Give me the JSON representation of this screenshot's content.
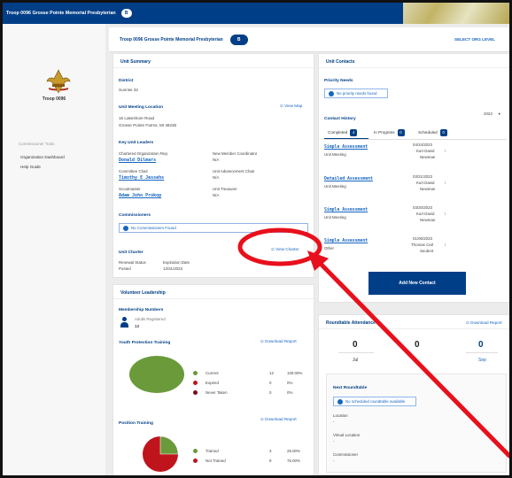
{
  "topbar": {
    "title": "Troop 0096 Grosse Pointe Memorial Presbyterian",
    "badge": "B"
  },
  "sidebar": {
    "troop_name": "Troop 0096",
    "section": "Commissioner Tools",
    "items": [
      {
        "label": "Organization Dashboard"
      },
      {
        "label": "Help Guide"
      }
    ]
  },
  "unit_header": {
    "title": "Troop 0096 Grosse Pointe Memorial Presbyterian",
    "badge": "B",
    "select_org": "SELECT ORG LEVEL"
  },
  "summary": {
    "title": "Unit Summary",
    "district_label": "District",
    "district": "Sunrise 32",
    "location_label": "Unit Meeting Location",
    "view_map": "View Map",
    "address1": "16 Lakeshore Road",
    "address2": "Grosse Pointe Farms, MI 48236",
    "leaders_label": "Key Unit Leaders",
    "leaders": [
      {
        "role": "Chartered Organization Rep.",
        "name": "Donald Dilmars"
      },
      {
        "role": "New Member Coordinator",
        "name": "N/A"
      },
      {
        "role": "Committee Chair",
        "name": "Timothy E Jessehs"
      },
      {
        "role": "Unit Advancement Chair",
        "name": "N/A"
      },
      {
        "role": "Scoutmaster",
        "name": "Adam John Prokop"
      },
      {
        "role": "Unit Treasurer",
        "name": "N/A"
      }
    ],
    "commissioners_label": "Commissioners",
    "no_commissioners": "No Commissioners Found",
    "charter_label": "Unit Charter",
    "view_charter": "View Charter",
    "renewal_label": "Renewal Status",
    "renewal_value": "Posted",
    "expiration_label": "Expiration Date",
    "expiration_value": "12/31/2023"
  },
  "volunteer": {
    "title": "Volunteer Leadership",
    "membership_label": "Membership Numbers",
    "adults_label": "Adults Registered",
    "adults_value": "13",
    "ypt_label": "Youth Protection Training",
    "download": "Download Report",
    "ypt_rows": [
      {
        "label": "Current",
        "count": "12",
        "pct": "100.00%"
      },
      {
        "label": "Expired",
        "count": "0",
        "pct": "0%"
      },
      {
        "label": "Never Taken",
        "count": "0",
        "pct": "0%"
      }
    ],
    "ypt_fraction": 1.0,
    "pos_label": "Position Training",
    "pos_rows": [
      {
        "label": "Trained",
        "count": "3",
        "pct": "25.00%"
      },
      {
        "label": "Not Trained",
        "count": "9",
        "pct": "75.00%"
      }
    ],
    "pos_trained_fraction": 0.25
  },
  "contacts": {
    "title": "Unit Contacts",
    "priority_label": "Priority Needs",
    "no_priority": "No priority needs found",
    "history_label": "Contact History",
    "year": "2023",
    "tabs": [
      {
        "label": "Completed",
        "count": "4"
      },
      {
        "label": "In Progress",
        "count": "0"
      },
      {
        "label": "Scheduled",
        "count": "0"
      }
    ],
    "items": [
      {
        "type": "Simple Assessment",
        "kind": "Unit Meeting",
        "date": "04/24/2023",
        "by1": "Kurt David",
        "by2": "Newman"
      },
      {
        "type": "Detailed Assessment",
        "kind": "Unit Meeting",
        "date": "03/21/2023",
        "by1": "Kurt David",
        "by2": "Newman"
      },
      {
        "type": "Simple Assessment",
        "kind": "Unit Meeting",
        "date": "03/20/2023",
        "by1": "Kurt David",
        "by2": "Newman"
      },
      {
        "type": "Simple Assessment",
        "kind": "Other",
        "date": "01/06/2023",
        "by1": "Thomas Carl",
        "by2": "Seubert"
      }
    ],
    "add_button": "Add New Contact"
  },
  "roundtable": {
    "title": "Roundtable Attendance",
    "download": "Download Report",
    "months": [
      {
        "count": "0",
        "month": "Jul"
      },
      {
        "count": "0",
        "month": ""
      },
      {
        "count": "0",
        "month": "Sep"
      }
    ],
    "next_label": "Next Roundtable",
    "no_roundtable": "No scheduled roundtable available",
    "location_label": "Location",
    "location_value": "-",
    "virtual_label": "Virtual Location",
    "virtual_value": "-",
    "commissioner_label": "Commissioner",
    "commissioner_value": "-"
  },
  "colors": {
    "brand": "#003f87",
    "link": "#1565c0",
    "current": "#6a9a3a",
    "expired": "#c0141c",
    "annotation": "#e8101c"
  }
}
